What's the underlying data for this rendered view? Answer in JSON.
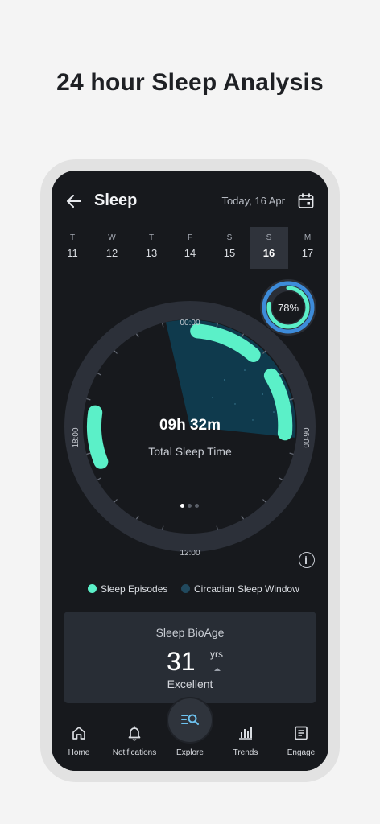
{
  "headline": "24 hour Sleep Analysis",
  "header": {
    "title": "Sleep",
    "date": "Today, 16 Apr"
  },
  "week": [
    {
      "dow": "T",
      "num": "11",
      "selected": false
    },
    {
      "dow": "W",
      "num": "12",
      "selected": false
    },
    {
      "dow": "T",
      "num": "13",
      "selected": false
    },
    {
      "dow": "F",
      "num": "14",
      "selected": false
    },
    {
      "dow": "S",
      "num": "15",
      "selected": false
    },
    {
      "dow": "S",
      "num": "16",
      "selected": true
    },
    {
      "dow": "M",
      "num": "17",
      "selected": false
    }
  ],
  "score": {
    "label": "78%",
    "percent": 78
  },
  "clock": {
    "labels": {
      "top": "00:00",
      "right": "06:00",
      "bottom": "12:00",
      "left": "18:00"
    },
    "total_sleep_time": "09h 32m",
    "total_sleep_label": "Total Sleep Time",
    "pager": {
      "pages": 3,
      "active": 0
    }
  },
  "legend": {
    "episodes": "Sleep Episodes",
    "window": "Circadian Sleep Window"
  },
  "bioage": {
    "title": "Sleep BioAge",
    "value": "31",
    "unit": "yrs",
    "status": "Excellent"
  },
  "nav": {
    "home": "Home",
    "notifications": "Notifications",
    "explore": "Explore",
    "trends": "Trends",
    "engage": "Engage"
  },
  "colors": {
    "accent_green": "#5bf0c8",
    "window_fill": "#0f3a4d",
    "ring": "#353944",
    "background": "#17191d",
    "score_blue": "#3d8bd9"
  },
  "icons": {
    "back": "arrow-left-icon",
    "calendar": "calendar-icon",
    "info": "info-icon",
    "home": "home-icon",
    "notifications": "bell-icon",
    "explore": "search-list-icon",
    "trends": "bar-chart-icon",
    "engage": "document-icon"
  }
}
